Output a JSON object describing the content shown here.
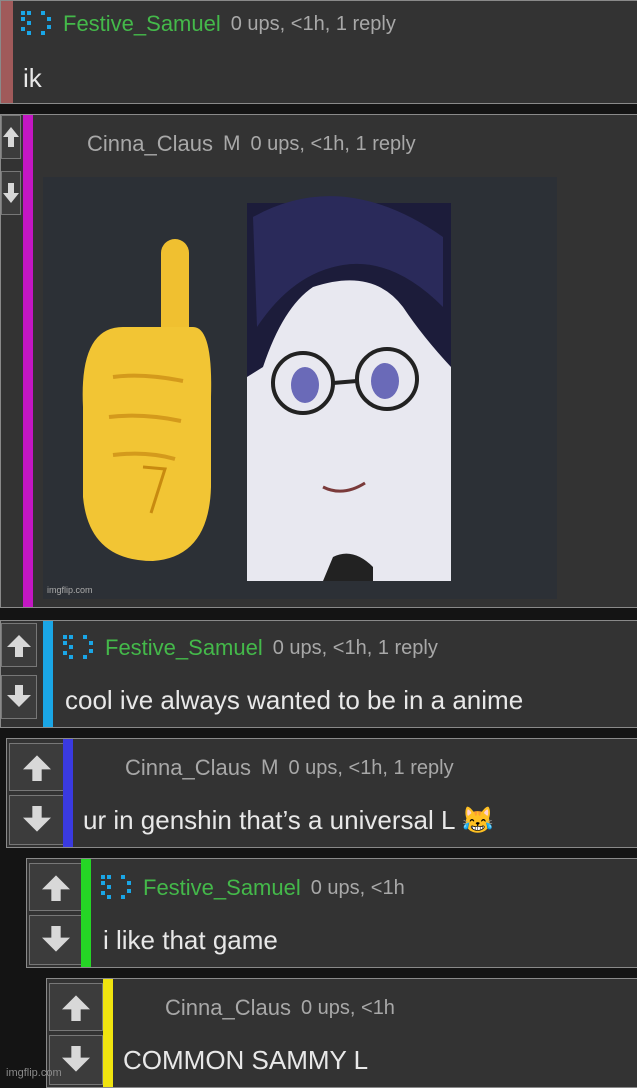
{
  "comments": [
    {
      "user": "Festive_Samuel",
      "mod": "",
      "meta": "0 ups, <1h, 1 reply",
      "body": "ik",
      "bar": "#a05a5a"
    },
    {
      "user": "Cinna_Claus",
      "mod": "M",
      "meta": "0 ups, <1h, 1 reply",
      "body": "",
      "bar": "#c317c3",
      "image_caption": "imgflip.com"
    },
    {
      "user": "Festive_Samuel",
      "mod": "",
      "meta": "0 ups, <1h, 1 reply",
      "body": "cool ive always wanted to be in a anime",
      "bar": "#1aa6e6"
    },
    {
      "user": "Cinna_Claus",
      "mod": "M",
      "meta": "0 ups, <1h, 1 reply",
      "body": "ur in genshin that’s a universal L 😹",
      "bar": "#3a3ae0"
    },
    {
      "user": "Festive_Samuel",
      "mod": "",
      "meta": "0 ups, <1h",
      "body": "i like that game",
      "bar": "#25d625"
    },
    {
      "user": "Cinna_Claus",
      "mod": "",
      "meta": "0 ups, <1h",
      "body": "COMMON SAMMY L",
      "bar": "#f0e40f"
    }
  ],
  "watermark": "imgflip.com",
  "colors": {
    "username_green": "#44b94a",
    "text": "#e8e8e8",
    "meta": "#a8a8a8",
    "panel": "#333333"
  }
}
